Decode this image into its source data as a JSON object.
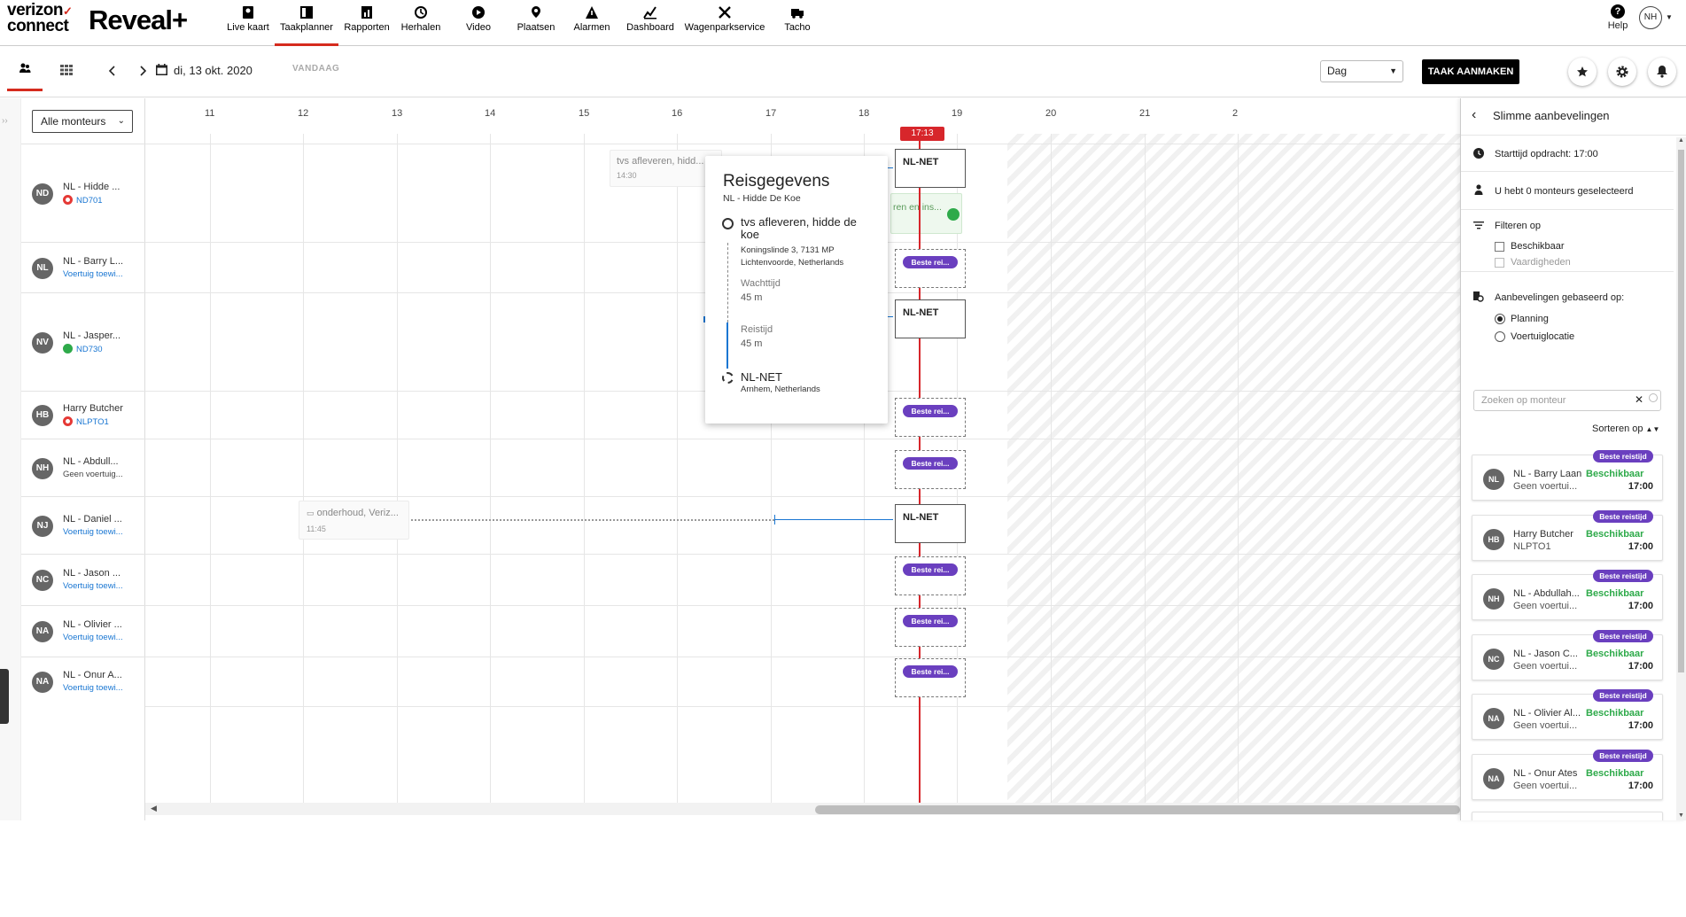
{
  "brand": {
    "logo_line1": "verizon",
    "logo_check": "✓",
    "logo_line2": "connect",
    "product": "Reveal+"
  },
  "nav": [
    {
      "label": "Live kaart",
      "icon": "map-icon"
    },
    {
      "label": "Taakplanner",
      "icon": "planner-icon",
      "active": true
    },
    {
      "label": "Rapporten",
      "icon": "reports-icon"
    },
    {
      "label": "Herhalen",
      "icon": "replay-icon"
    },
    {
      "label": "Video",
      "icon": "video-icon"
    },
    {
      "label": "Plaatsen",
      "icon": "places-icon"
    },
    {
      "label": "Alarmen",
      "icon": "alarm-icon"
    },
    {
      "label": "Dashboard",
      "icon": "dashboard-icon"
    },
    {
      "label": "Wagenparkservice",
      "icon": "fleet-service-icon"
    },
    {
      "label": "Tacho",
      "icon": "tacho-icon"
    }
  ],
  "help_label": "Help",
  "user_initials": "NH",
  "toolbar": {
    "date": "di, 13 okt. 2020",
    "today": "VANDAAG",
    "view": "Dag",
    "create": "TAAK AANMAKEN"
  },
  "resource_filter": "Alle monteurs",
  "resources": [
    {
      "initials": "ND",
      "name": "NL - Hidde ...",
      "sub": "ND701",
      "status": "red"
    },
    {
      "initials": "NL",
      "name": "NL - Barry L...",
      "sub": "Voertuig toewi...",
      "status": "link"
    },
    {
      "initials": "NV",
      "name": "NL - Jasper...",
      "sub": "ND730",
      "status": "green"
    },
    {
      "initials": "HB",
      "name": "Harry Butcher",
      "sub": "NLPTO1",
      "status": "red"
    },
    {
      "initials": "NH",
      "name": "NL - Abdull...",
      "sub": "Geen voertuig...",
      "status": "none"
    },
    {
      "initials": "NJ",
      "name": "NL - Daniel ...",
      "sub": "Voertuig toewi...",
      "status": "link"
    },
    {
      "initials": "NC",
      "name": "NL - Jason ...",
      "sub": "Voertuig toewi...",
      "status": "link"
    },
    {
      "initials": "NA",
      "name": "NL - Olivier ...",
      "sub": "Voertuig toewi...",
      "status": "link"
    },
    {
      "initials": "NA",
      "name": "NL - Onur A...",
      "sub": "Voertuig toewi...",
      "status": "link"
    }
  ],
  "hours": [
    "11",
    "12",
    "13",
    "14",
    "15",
    "16",
    "17",
    "18",
    "19",
    "20",
    "21",
    "2"
  ],
  "now_time": "17:13",
  "slots": [
    {
      "text": "NL-NET",
      "pill": false
    },
    {
      "text": "Beste rei...",
      "pill": true
    },
    {
      "text": "NL-NET",
      "pill": false
    },
    {
      "text": "Beste rei...",
      "pill": true
    },
    {
      "text": "Beste rei...",
      "pill": true
    },
    {
      "text": "NL-NET",
      "pill": false
    },
    {
      "text": "Beste rei...",
      "pill": true
    },
    {
      "text": "Beste rei...",
      "pill": true
    },
    {
      "text": "Beste rei...",
      "pill": true
    }
  ],
  "tasks": {
    "hidde_task": {
      "title": "tvs afleveren, hidd...",
      "time": "14:30"
    },
    "green_task": {
      "title": "ren en ins..."
    },
    "daniel_task": {
      "title": "onderhoud, Veriz...",
      "time": "11:45"
    }
  },
  "popover": {
    "title": "Reisgegevens",
    "subtitle": "NL - Hidde De Koe",
    "from": "tvs afleveren, hidde de koe",
    "from_addr1": "Koningslinde 3, 7131 MP",
    "from_addr2": "Lichtenvoorde, Netherlands",
    "wait_label": "Wachttijd",
    "wait_value": "45 m",
    "travel_label": "Reistijd",
    "travel_value": "45 m",
    "to": "NL-NET",
    "to_addr": "Arnhem, Netherlands"
  },
  "panel": {
    "title": "Slimme aanbevelingen",
    "start": "Starttijd opdracht: 17:00",
    "selected": "U hebt 0 monteurs geselecteerd",
    "filter_title": "Filteren op",
    "filter_available": "Beschikbaar",
    "filter_skills": "Vaardigheden",
    "basis_title": "Aanbevelingen gebaseerd op:",
    "basis_planning": "Planning",
    "basis_location": "Voertuiglocatie",
    "search_placeholder": "Zoeken op monteur",
    "sort": "Sorteren op",
    "cards": [
      {
        "initials": "NL",
        "name": "NL - Barry Laan",
        "sub": "Geen voertui...",
        "badge": "Beste reistijd",
        "status": "Beschikbaar",
        "time": "17:00"
      },
      {
        "initials": "HB",
        "name": "Harry Butcher",
        "sub": "NLPTO1",
        "badge": "Beste reistijd",
        "status": "Beschikbaar",
        "time": "17:00"
      },
      {
        "initials": "NH",
        "name": "NL - Abdullah...",
        "sub": "Geen voertui...",
        "badge": "Beste reistijd",
        "status": "Beschikbaar",
        "time": "17:00"
      },
      {
        "initials": "NC",
        "name": "NL - Jason C...",
        "sub": "Geen voertui...",
        "badge": "Beste reistijd",
        "status": "Beschikbaar",
        "time": "17:00"
      },
      {
        "initials": "NA",
        "name": "NL - Olivier Al...",
        "sub": "Geen voertui...",
        "badge": "Beste reistijd",
        "status": "Beschikbaar",
        "time": "17:00"
      },
      {
        "initials": "NA",
        "name": "NL - Onur Ates",
        "sub": "Geen voertui...",
        "badge": "Beste reistijd",
        "status": "Beschikbaar",
        "time": "17:00"
      }
    ]
  },
  "colors": {
    "accent": "#d52b1e",
    "pill": "#6a3fbf",
    "available": "#2eaa4a",
    "link": "#1976d2"
  }
}
